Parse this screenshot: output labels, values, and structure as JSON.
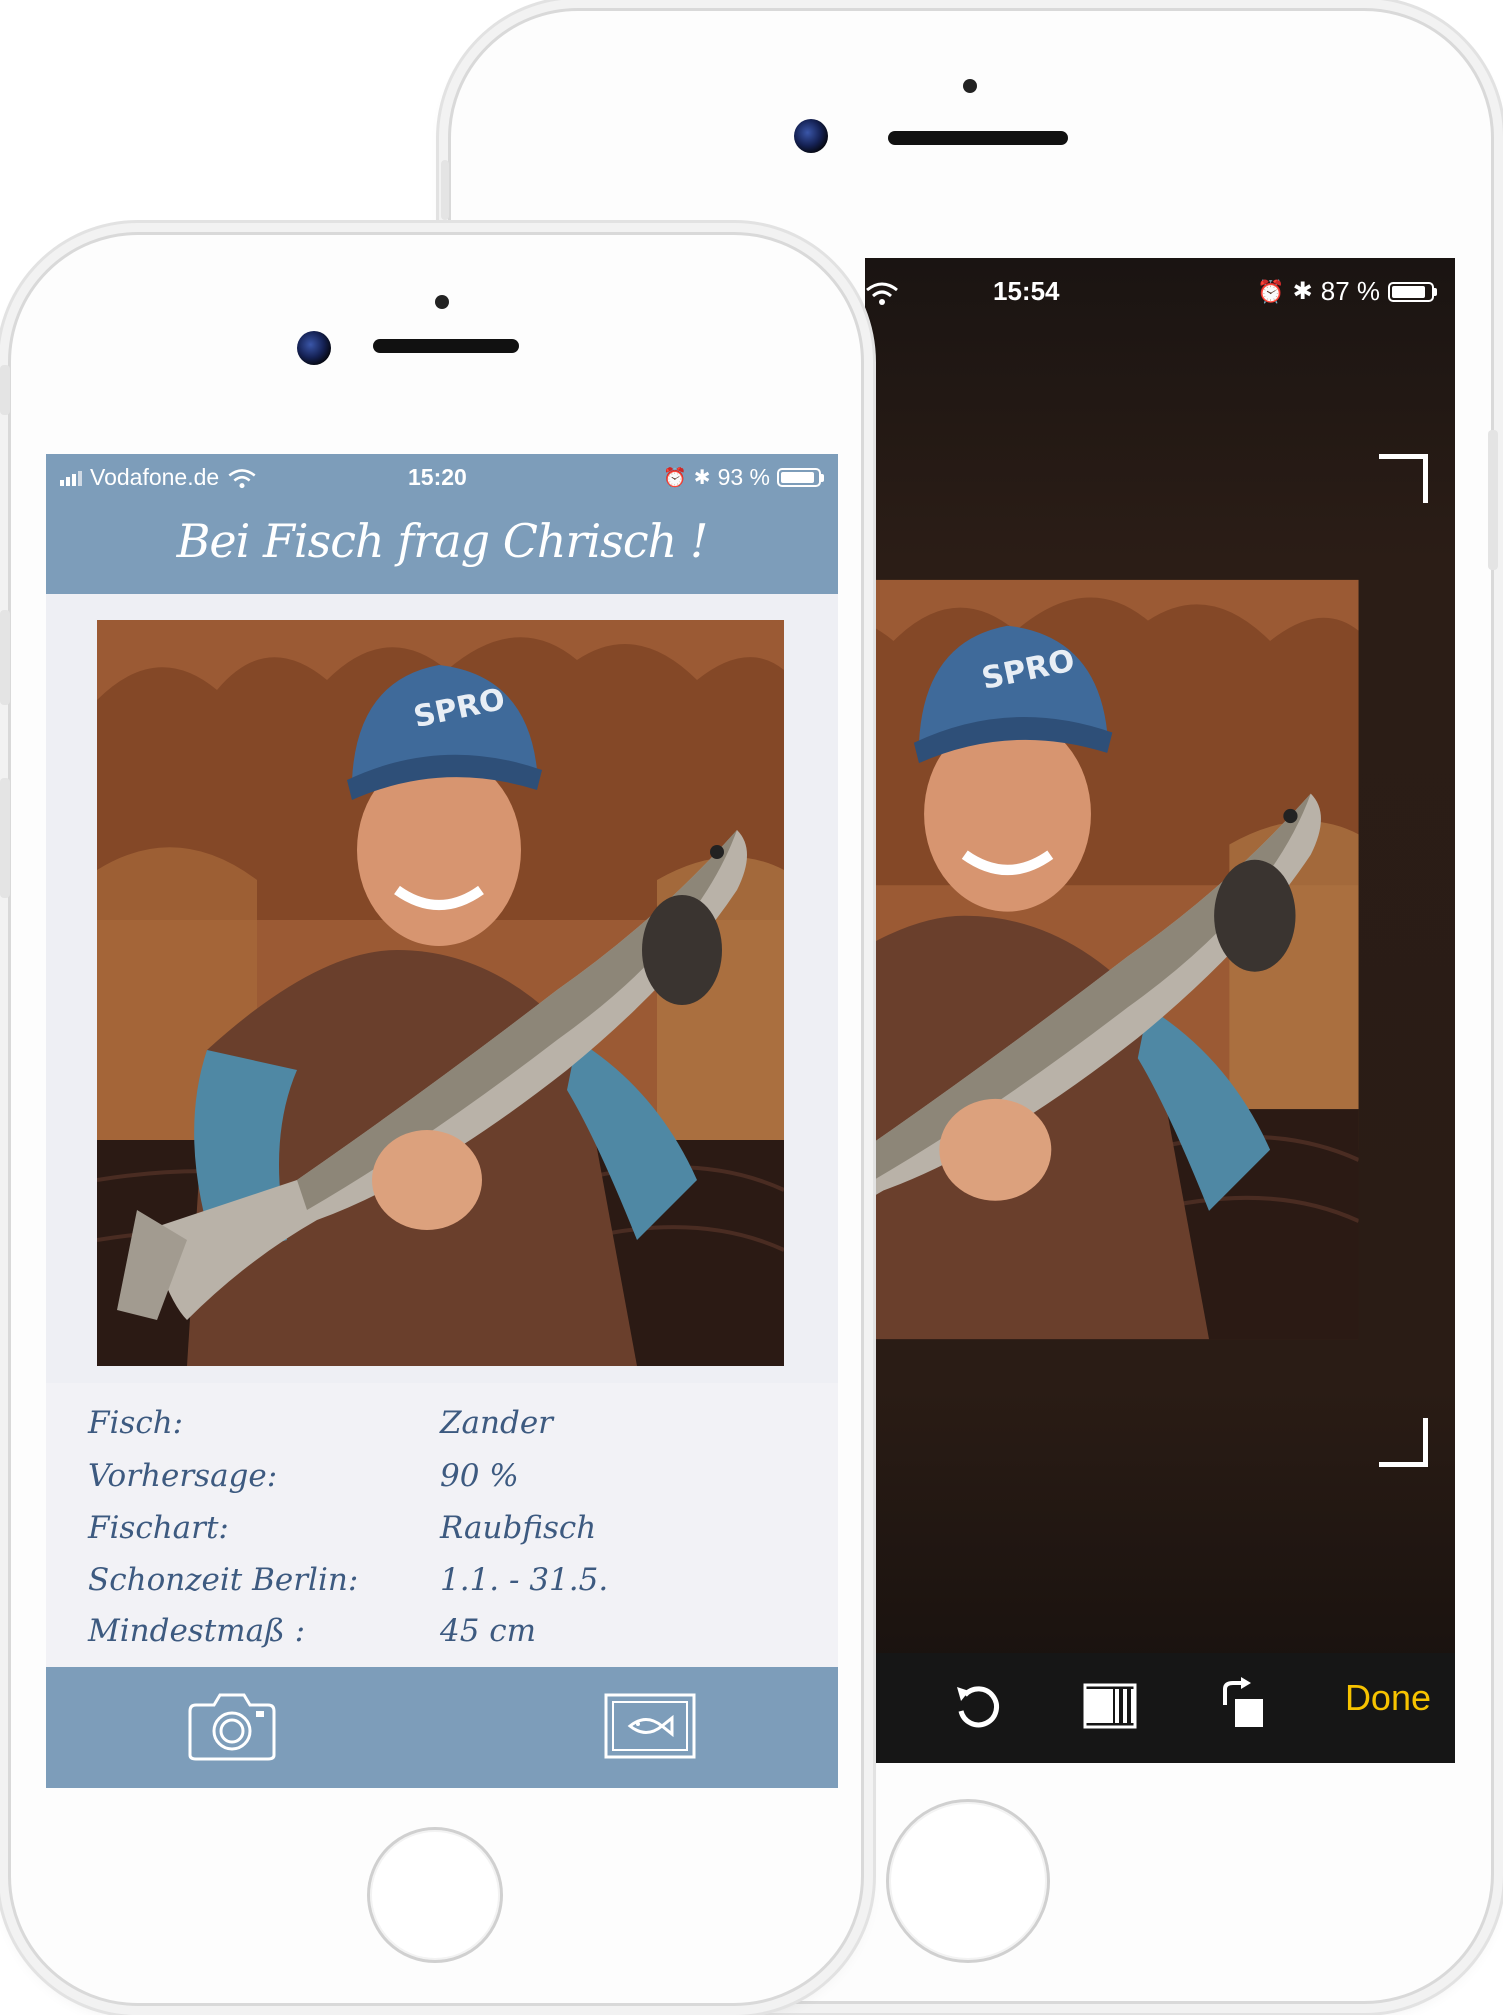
{
  "back_phone": {
    "status": {
      "time": "15:54",
      "battery": "87 %",
      "battery_level": 0.87
    },
    "toolbar": {
      "done_label": "Done"
    },
    "icons": [
      "wifi-icon",
      "alarm-icon",
      "bluetooth-icon",
      "battery-icon",
      "rotate-icon",
      "aspect-ratio-icon",
      "rotate-right-icon"
    ]
  },
  "front_phone": {
    "status": {
      "carrier": "Vodafone.de",
      "time": "15:20",
      "battery": "93 %",
      "battery_level": 0.93
    },
    "title": "Bei Fisch frag Chrisch !",
    "info": [
      {
        "label": "Fisch:",
        "value": "Zander"
      },
      {
        "label": "Vorhersage:",
        "value": "90 %"
      },
      {
        "label": "Fischart:",
        "value": "Raubfisch"
      },
      {
        "label": "Schonzeit Berlin:",
        "value": "1.1. - 31.5."
      },
      {
        "label": "Mindestmaß :",
        "value": "45 cm"
      }
    ],
    "tabbar": {
      "icons": [
        "camera-icon",
        "fish-gallery-icon"
      ]
    }
  },
  "colors": {
    "header": "#7d9dba",
    "text": "#3d5a80",
    "done": "#f7c300",
    "panel": "#f2f2f6"
  }
}
